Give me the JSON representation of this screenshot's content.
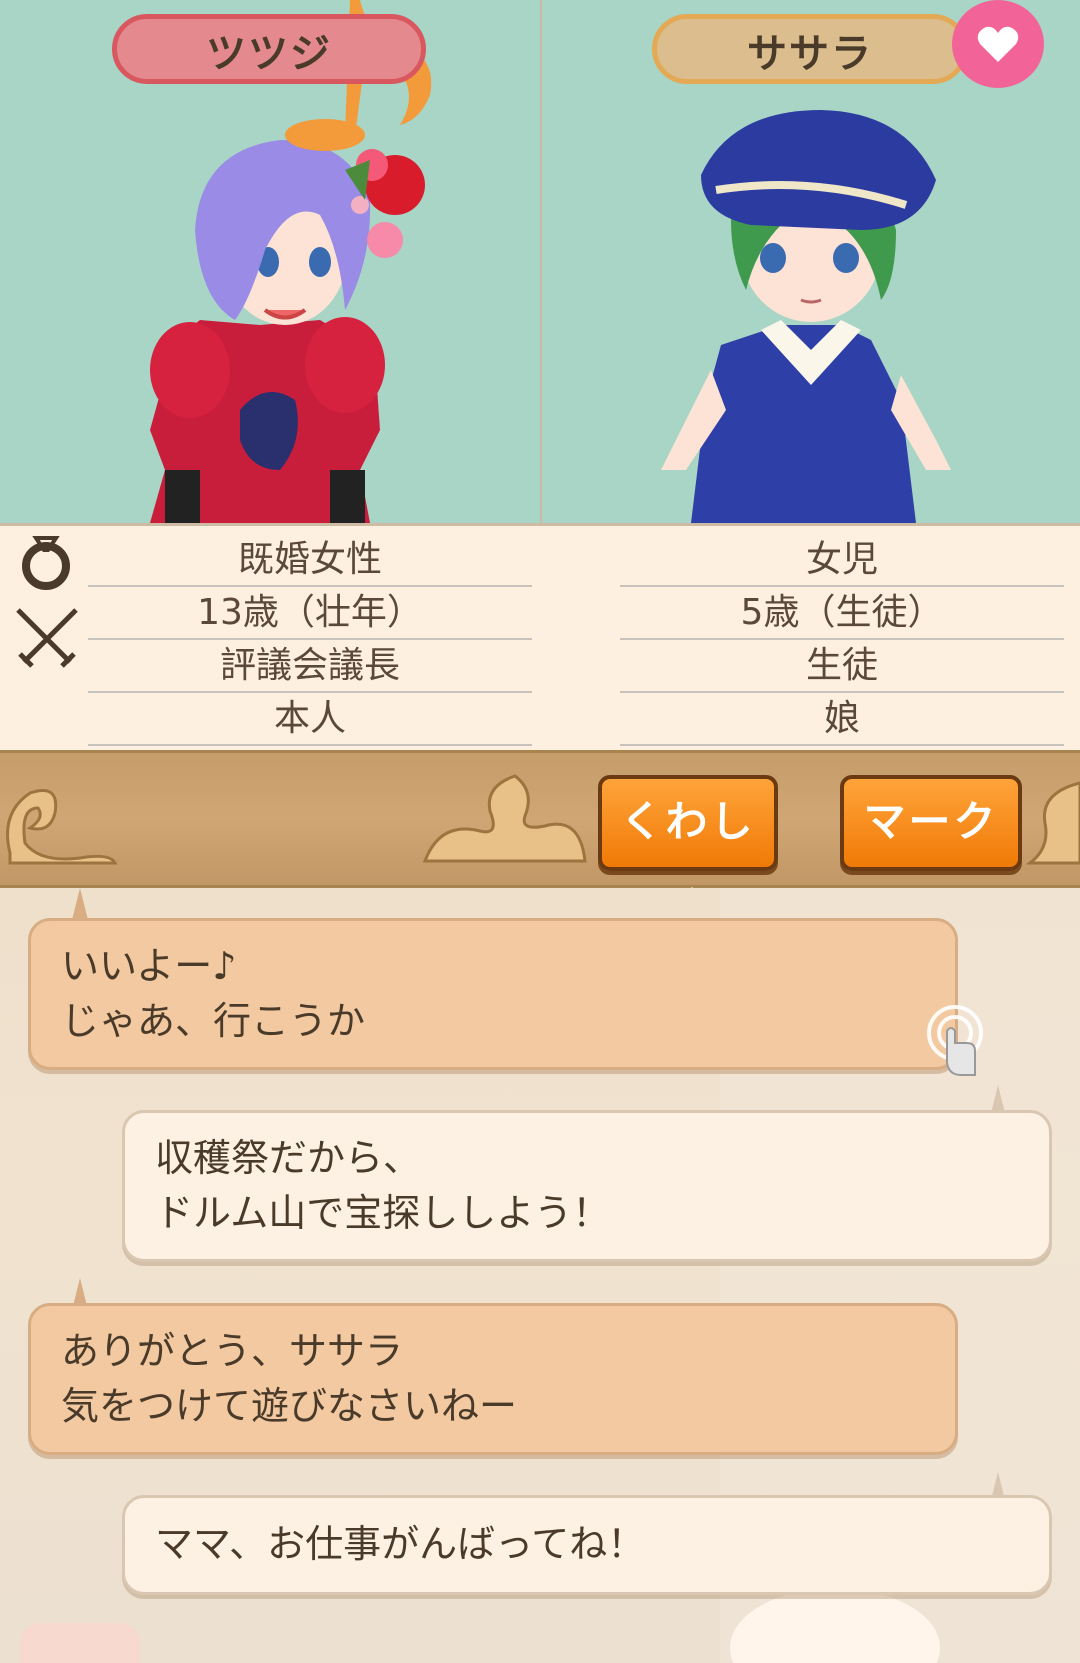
{
  "left_character": {
    "name": "ツツジ",
    "info": [
      "既婚女性",
      "13歳（壮年）",
      "評議会議長",
      "本人"
    ]
  },
  "right_character": {
    "name": "ササラ",
    "info": [
      "女児",
      "5歳（生徒）",
      "生徒",
      "娘"
    ]
  },
  "icons": {
    "heart": "heart-icon",
    "marriage": "ring-icon",
    "combat": "crossed-swords-icon",
    "tap": "tap-icon",
    "note": "music-note-icon"
  },
  "buttons": {
    "details_label": "くわしく",
    "mark_label": "マーク"
  },
  "chat": [
    {
      "side": "in",
      "lines": [
        "いいよー♪",
        "じゃあ、行こうか"
      ]
    },
    {
      "side": "out",
      "lines": [
        "収穫祭だから、",
        "ドルム山で宝探ししよう！"
      ]
    },
    {
      "side": "in",
      "lines": [
        "ありがとう、ササラ",
        "気をつけて遊びなさいねー"
      ]
    },
    {
      "side": "out",
      "lines": [
        "ママ、お仕事がんばってね！"
      ]
    }
  ],
  "colors": {
    "portrait_bg": "#a8d5c6",
    "left_plate": "#e48a8f",
    "right_plate": "#dbbd8e",
    "heart_badge": "#f26497",
    "button_orange": "#f7901e",
    "incoming_bubble": "#f2c9a0",
    "outgoing_bubble": "#fdf1e3"
  }
}
